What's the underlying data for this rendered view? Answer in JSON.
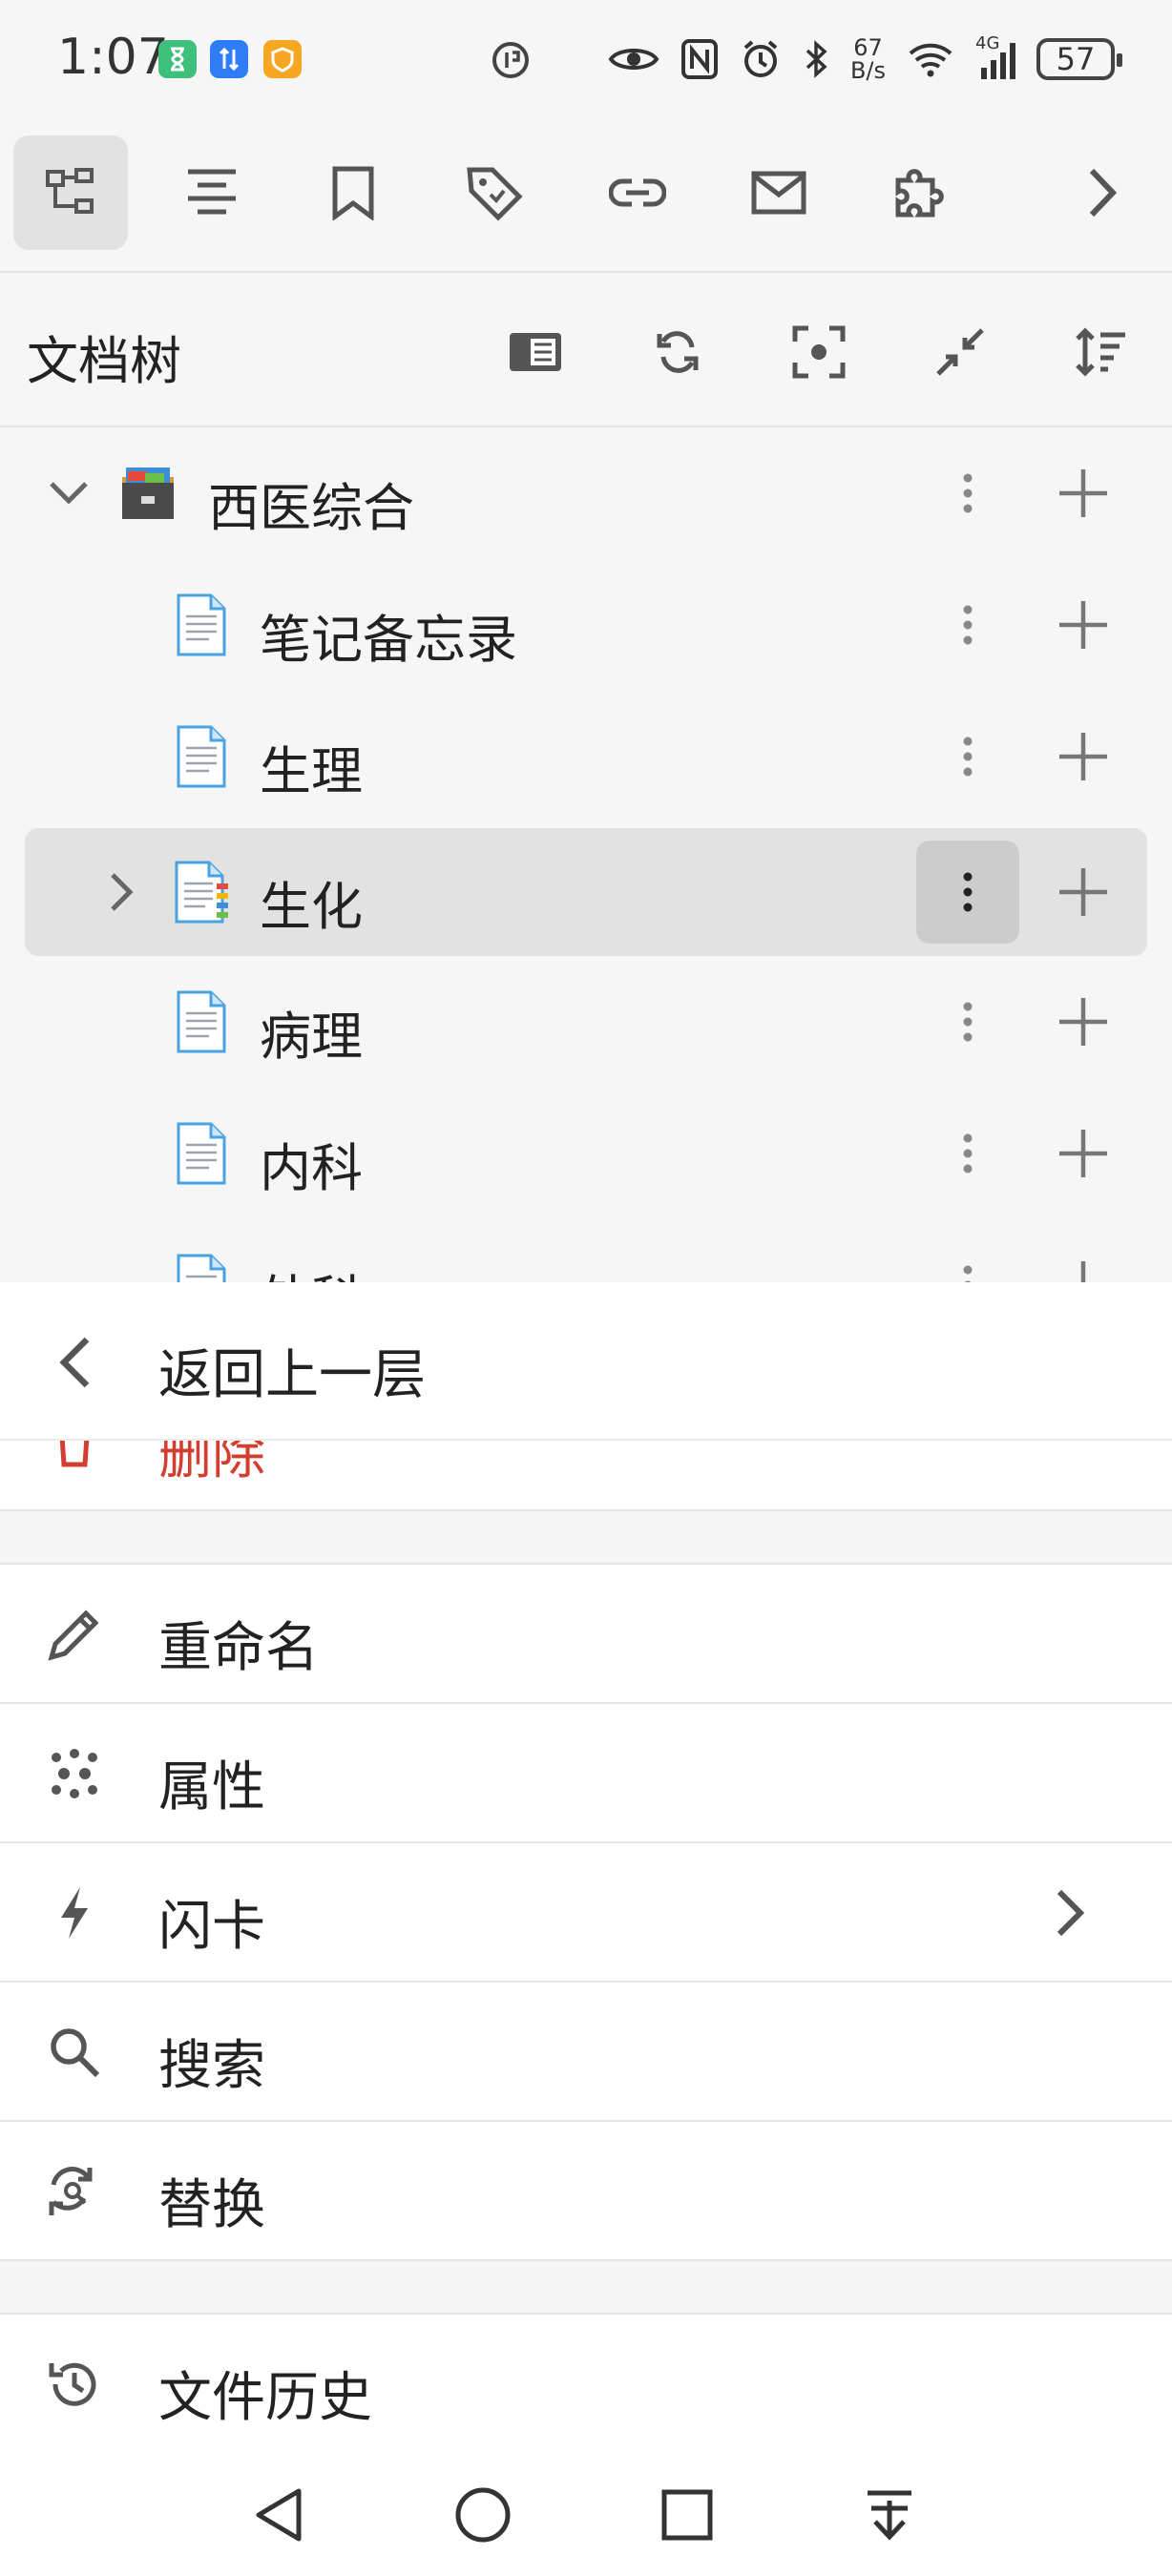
{
  "status_bar": {
    "time": "1:07",
    "net_speed_value": "67",
    "net_speed_unit": "B/s",
    "network_type": "4G",
    "battery": "57"
  },
  "dock": {
    "buttons": [
      {
        "icon": "file-tree-icon",
        "active": true
      },
      {
        "icon": "outline-icon"
      },
      {
        "icon": "bookmark-icon"
      },
      {
        "icon": "tag-icon"
      },
      {
        "icon": "link-icon"
      },
      {
        "icon": "mail-icon"
      },
      {
        "icon": "plugin-icon"
      },
      {
        "icon": "chevron-right-icon"
      }
    ]
  },
  "tree": {
    "title": "文档树",
    "header_actions": [
      "focus-panel-icon",
      "refresh-icon",
      "locate-icon",
      "collapse-icon",
      "sort-icon"
    ],
    "notebook": {
      "label": "西医综合",
      "icon": "notebook-box-icon"
    },
    "docs": [
      {
        "label": "笔记备忘录"
      },
      {
        "label": "生理"
      },
      {
        "label": "生化",
        "selected": true,
        "has_children": true
      },
      {
        "label": "病理"
      },
      {
        "label": "内科"
      },
      {
        "label": "外科"
      }
    ]
  },
  "menu": {
    "back_label": "返回上一层",
    "delete_label": "删除",
    "items": [
      {
        "label": "重命名",
        "icon": "pencil-icon"
      },
      {
        "label": "属性",
        "icon": "attributes-icon"
      },
      {
        "label": "闪卡",
        "icon": "lightning-icon",
        "submenu": true
      },
      {
        "label": "搜索",
        "icon": "search-icon"
      },
      {
        "label": "替换",
        "icon": "replace-icon"
      }
    ],
    "history_label": "文件历史"
  },
  "colors": {
    "danger": "#d23f31",
    "icon_gray": "#5f6368",
    "selected_row": "#e2e2e2"
  }
}
